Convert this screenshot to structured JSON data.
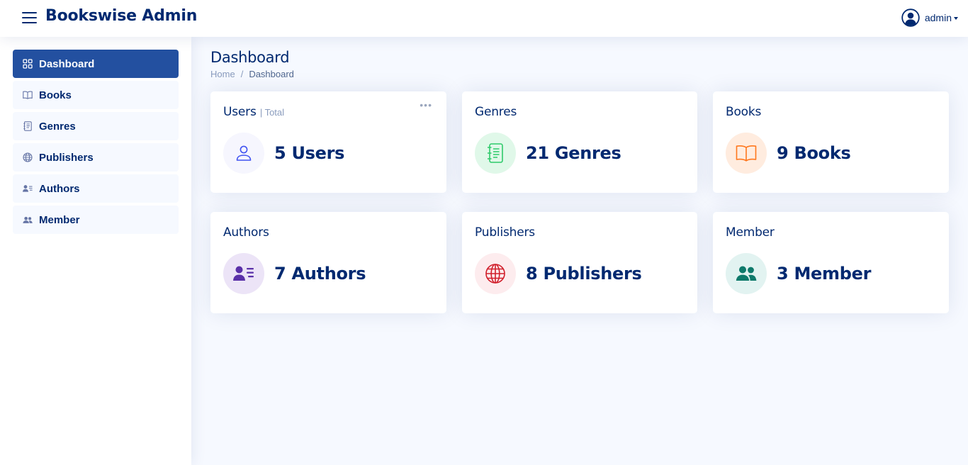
{
  "header": {
    "brand": "Bookswise Admin",
    "user_name": "admin"
  },
  "sidebar": {
    "items": [
      {
        "label": "Dashboard",
        "icon": "grid-icon",
        "active": true
      },
      {
        "label": "Books",
        "icon": "book-icon"
      },
      {
        "label": "Genres",
        "icon": "journal-icon"
      },
      {
        "label": "Publishers",
        "icon": "globe-icon"
      },
      {
        "label": "Authors",
        "icon": "person-lines-icon"
      },
      {
        "label": "Member",
        "icon": "people-icon"
      }
    ]
  },
  "page": {
    "title": "Dashboard",
    "breadcrumb": [
      "Home",
      "Dashboard"
    ]
  },
  "cards": [
    {
      "title": "Users",
      "subtitle": "| Total",
      "value": "5 Users",
      "icon": "person-icon",
      "color": "#4154f1",
      "bg": "#f6f6fe"
    },
    {
      "title": "Genres",
      "value": "21 Genres",
      "icon": "journal-icon",
      "color": "#2eca6a",
      "bg": "#e0f8e9"
    },
    {
      "title": "Books",
      "value": "9 Books",
      "icon": "book-open-icon",
      "color": "#ff771d",
      "bg": "#ffecdf"
    },
    {
      "title": "Authors",
      "value": "7 Authors",
      "icon": "person-lines-icon",
      "color": "#5a30a8",
      "bg": "#ece4f7"
    },
    {
      "title": "Publishers",
      "value": "8 Publishers",
      "icon": "globe-icon",
      "color": "#d11f2b",
      "bg": "#fdecee"
    },
    {
      "title": "Member",
      "value": "3 Member",
      "icon": "people-icon",
      "color": "#0f7a6b",
      "bg": "#e2f3f1"
    }
  ]
}
